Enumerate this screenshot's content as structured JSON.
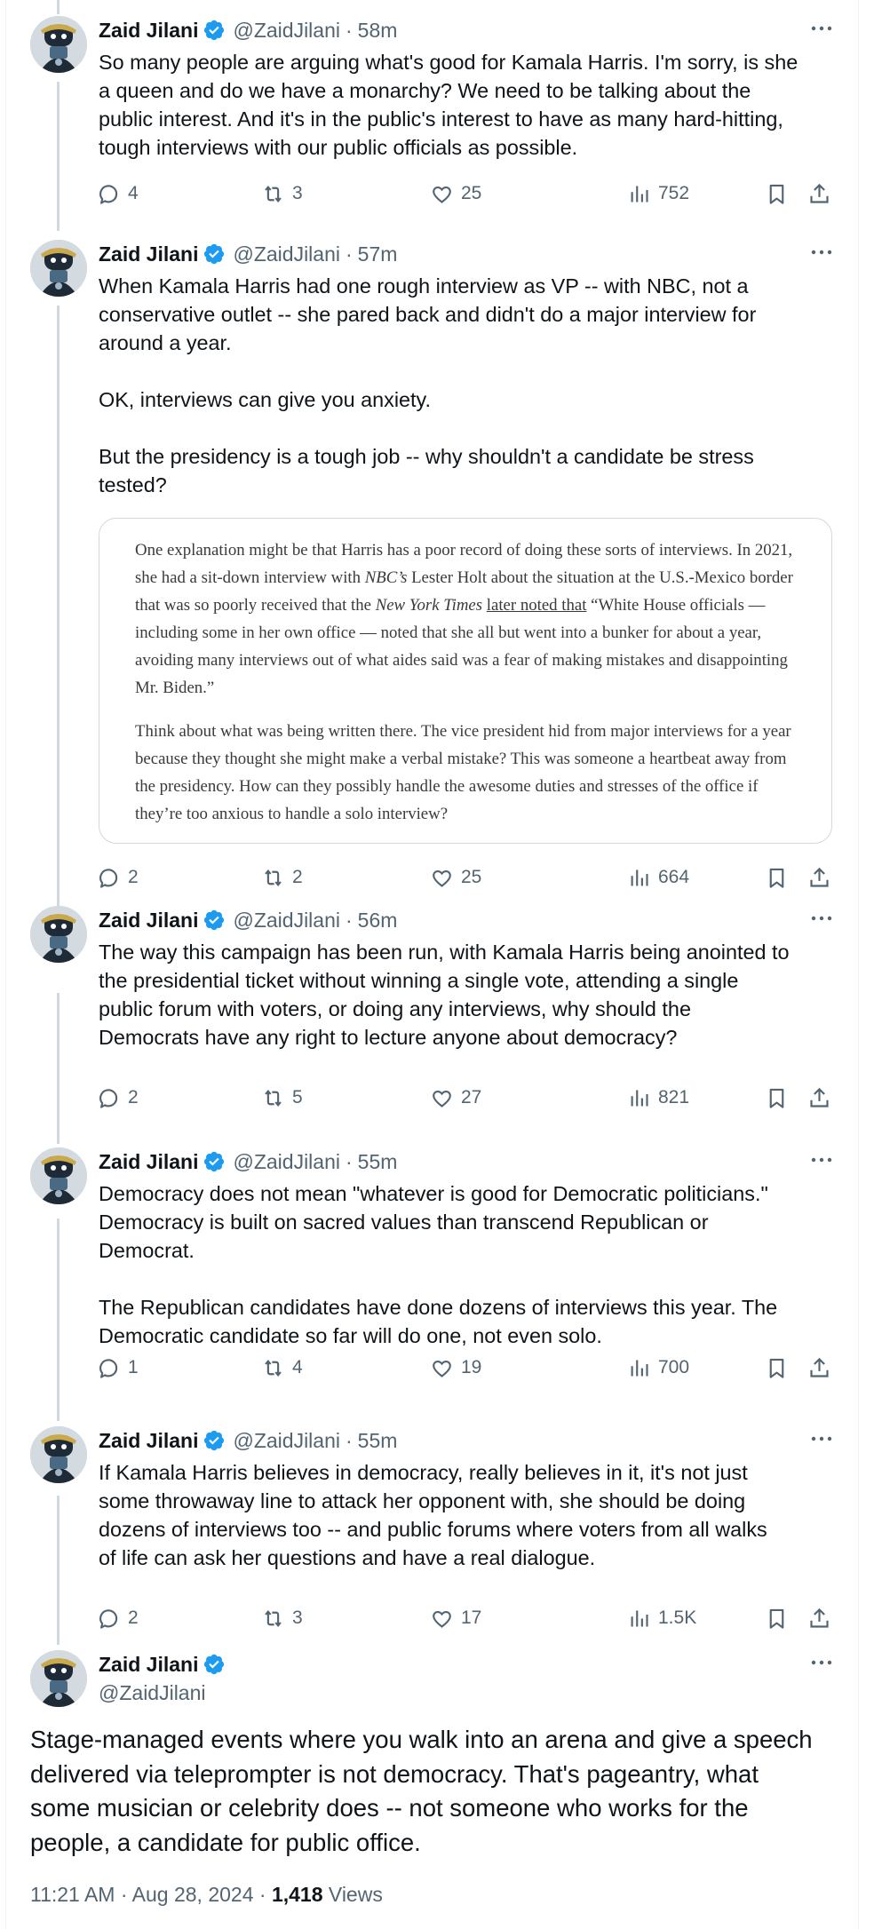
{
  "author": {
    "name": "Zaid Jilani",
    "handle": "@ZaidJilani"
  },
  "thread": [
    {
      "time": "58m",
      "text": "So many people are arguing what's good for Kamala Harris. I'm sorry, is she\na queen and do we have a monarchy? We need to be talking about the\npublic interest. And it's in the public's interest to have as many hard-hitting,\ntough interviews with our public officials as possible.",
      "replies": "4",
      "reposts": "3",
      "likes": "25",
      "views": "752"
    },
    {
      "time": "57m",
      "text": "When Kamala Harris had one rough interview as VP -- with NBC, not a\nconservative outlet -- she pared back and didn't do a major interview for\naround a year.\n\nOK, interviews can give you anxiety.\n\nBut the presidency is a tough job -- why shouldn't a candidate be stress\ntested?",
      "replies": "2",
      "reposts": "2",
      "likes": "25",
      "views": "664"
    },
    {
      "time": "56m",
      "text": "The way this campaign has been run, with Kamala Harris being anointed to\nthe presidential ticket without winning a single vote, attending a single\npublic forum with voters, or doing any interviews, why should the\nDemocrats have any right to lecture anyone about democracy?",
      "replies": "2",
      "reposts": "5",
      "likes": "27",
      "views": "821"
    },
    {
      "time": "55m",
      "text": "Democracy does not mean \"whatever is good for Democratic politicians.\"\nDemocracy is built on sacred values than transcend Republican or\nDemocrat.\n\nThe Republican candidates have done dozens of interviews this year. The\nDemocratic candidate so far will do one, not even solo.",
      "replies": "1",
      "reposts": "4",
      "likes": "19",
      "views": "700"
    },
    {
      "time": "55m",
      "text": "If Kamala Harris believes in democracy, really believes in it, it's not just\nsome throwaway line to attack her opponent with, she should be doing\ndozens of interviews too -- and public forums where voters from all walks\nof life can ask her questions and have a real dialogue.",
      "replies": "2",
      "reposts": "3",
      "likes": "17",
      "views": "1.5K"
    }
  ],
  "quote_image": {
    "p1_a": "One explanation might be that Harris has a poor record of doing these sorts of interviews. In 2021, she had a sit-down interview with ",
    "p1_nbc": "NBC’s",
    "p1_b": " Lester Holt about the situation at the U.S.-Mexico border that was so poorly received that the ",
    "p1_nyt": "New York Times",
    "p1_c": " ",
    "p1_link": "later noted that",
    "p1_d": " “White House officials — including some in her own office — noted that she all but went into a bunker for about a year, avoiding many interviews out of what aides said was a fear of making mistakes and disappointing Mr. Biden.”",
    "p2": "Think about what was being written there. The vice president hid from major interviews for a year because they thought she might make a verbal mistake? This was someone a heartbeat away from the presidency. How can they possibly handle the awesome duties and stresses of the office if they’re too anxious to handle a solo interview?"
  },
  "main_tweet": {
    "text": "Stage-managed events where you walk into an arena and give a speech\ndelivered via teleprompter is not democracy. That's pageantry, what\nsome musician or celebrity does -- not someone who works for the\npeople, a candidate for public office.",
    "timestamp": "11:21 AM · Aug 28, 2024 · ",
    "views_count": "1,418",
    "views_label": " Views"
  },
  "separator": "·",
  "icons": [
    "verified-badge",
    "more-icon",
    "reply-icon",
    "repost-icon",
    "like-icon",
    "views-icon",
    "bookmark-icon",
    "share-icon"
  ],
  "colors": {
    "verified": "#1d9bf0",
    "muted": "#536471",
    "text": "#0f1419",
    "thread_line": "#cfd9de"
  }
}
